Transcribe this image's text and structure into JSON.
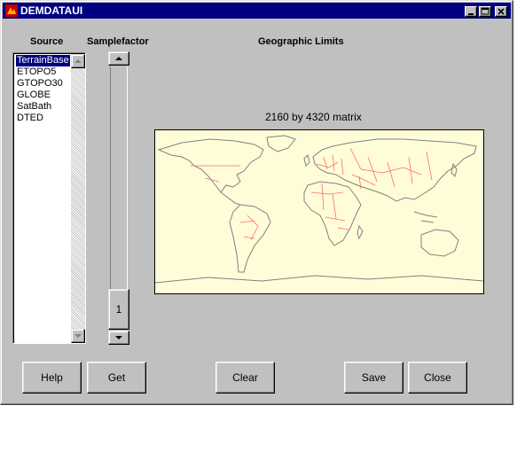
{
  "window": {
    "title": "DEMDATAUI"
  },
  "labels": {
    "source": "Source",
    "samplefactor": "Samplefactor",
    "geo_limits": "Geographic Limits",
    "matrix_info": "2160 by 4320 matrix"
  },
  "source_list": {
    "items": [
      "TerrainBase",
      "ETOPO5",
      "GTOPO30",
      "GLOBE",
      "SatBath",
      "DTED"
    ],
    "selected": "TerrainBase"
  },
  "samplefactor": {
    "value": "1"
  },
  "buttons": {
    "help": "Help",
    "get": "Get",
    "clear": "Clear",
    "save": "Save",
    "close": "Close"
  },
  "map": {
    "background": "#fffdd8",
    "coast_color": "#808080",
    "border_color": "#ff6060"
  },
  "colors": {
    "titlebar": "#000080",
    "face": "#c0c0c0"
  }
}
